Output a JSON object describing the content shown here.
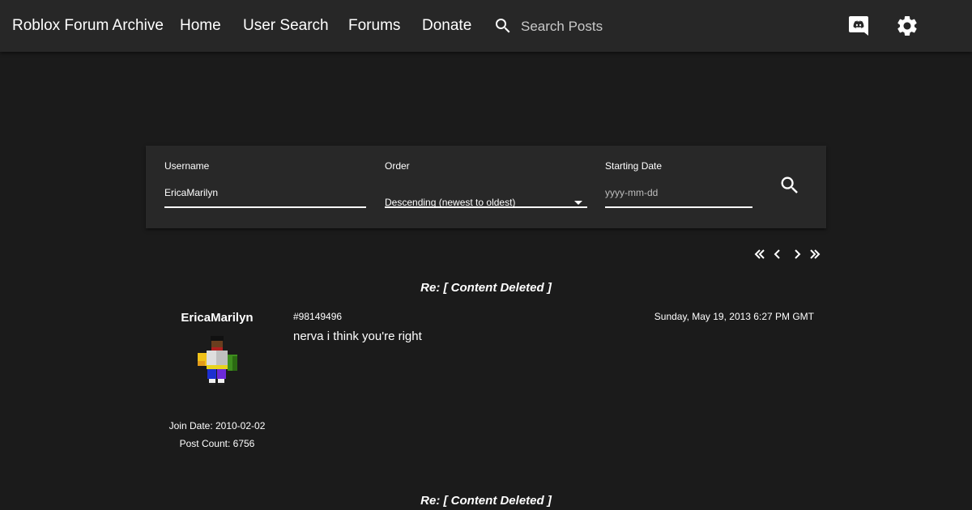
{
  "nav": {
    "brand": "Roblox Forum Archive",
    "home": "Home",
    "user_search": "User Search",
    "forums": "Forums",
    "donate": "Donate",
    "search_placeholder": "Search Posts"
  },
  "search_panel": {
    "username_label": "Username",
    "username_value": "EricaMarilyn",
    "order_label": "Order",
    "order_value": "Descending (newest to oldest)",
    "date_label": "Starting Date",
    "date_placeholder": "yyyy-mm-dd"
  },
  "posts": [
    {
      "title": "Re: [ Content Deleted ]",
      "author": "EricaMarilyn",
      "join_date": "Join Date: 2010-02-02",
      "post_count": "Post Count: 6756",
      "id": "#98149496",
      "date": "Sunday, May 19, 2013 6:27 PM GMT",
      "body": "nerva i think you're right"
    },
    {
      "title": "Re: [ Content Deleted ]"
    }
  ],
  "colors": {
    "background": "#1b1b1b",
    "topbar": "#272727",
    "panel": "#282828",
    "text": "#ffffff"
  },
  "icons": [
    "search-icon",
    "discord-icon",
    "gear-icon",
    "caret-down-icon",
    "first-page-icon",
    "prev-page-icon",
    "next-page-icon",
    "last-page-icon"
  ]
}
